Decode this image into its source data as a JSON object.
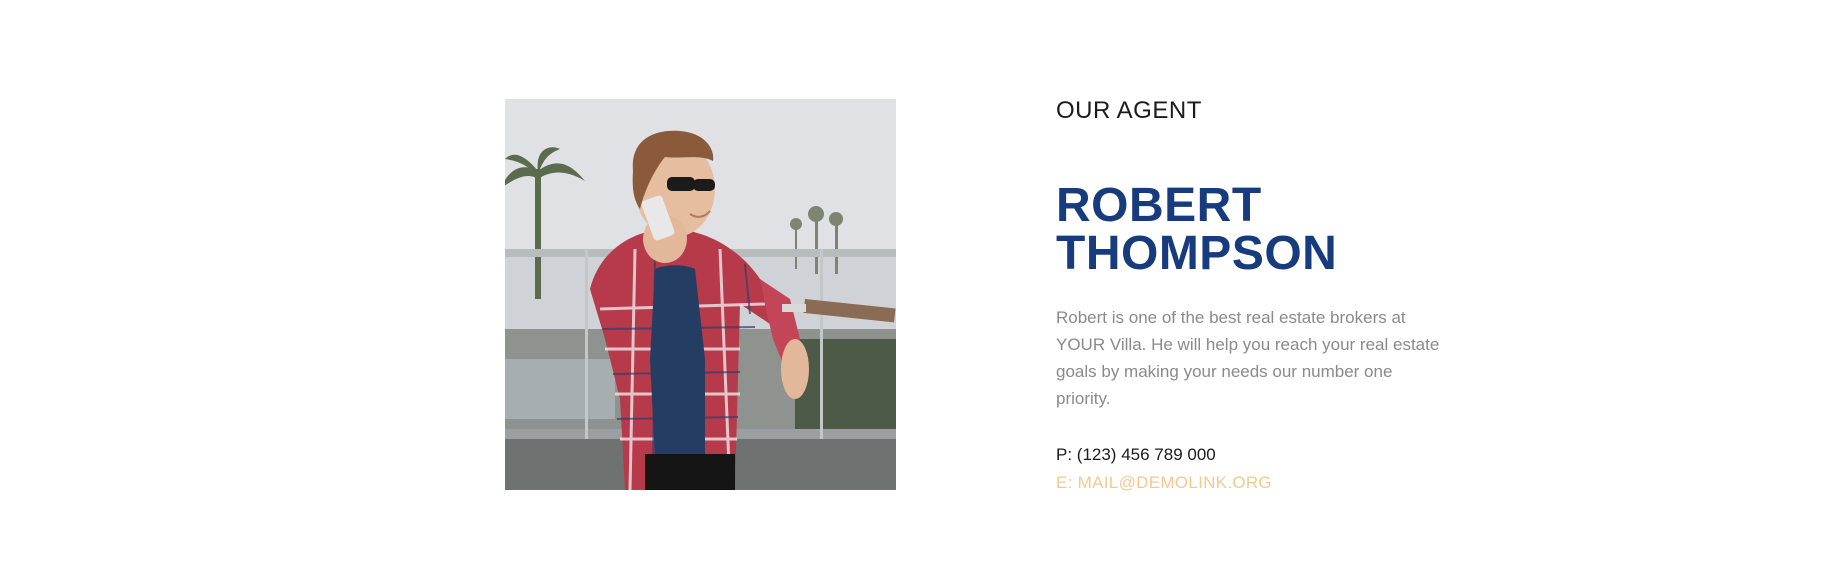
{
  "agent": {
    "eyebrow": "OUR AGENT",
    "name": "ROBERT\nTHOMPSON",
    "bio": "Robert is one of the best real estate brokers at YOUR Villa. He will help you reach your real estate goals by making your needs our number one priority.",
    "phone": "P: (123) 456 789 000",
    "email": "E: MAIL@DEMOLINK.ORG"
  },
  "colors": {
    "name": "#163c7d",
    "email": "#f3c98f",
    "body_text": "#8a8a8a",
    "heading": "#1b1b1b"
  }
}
